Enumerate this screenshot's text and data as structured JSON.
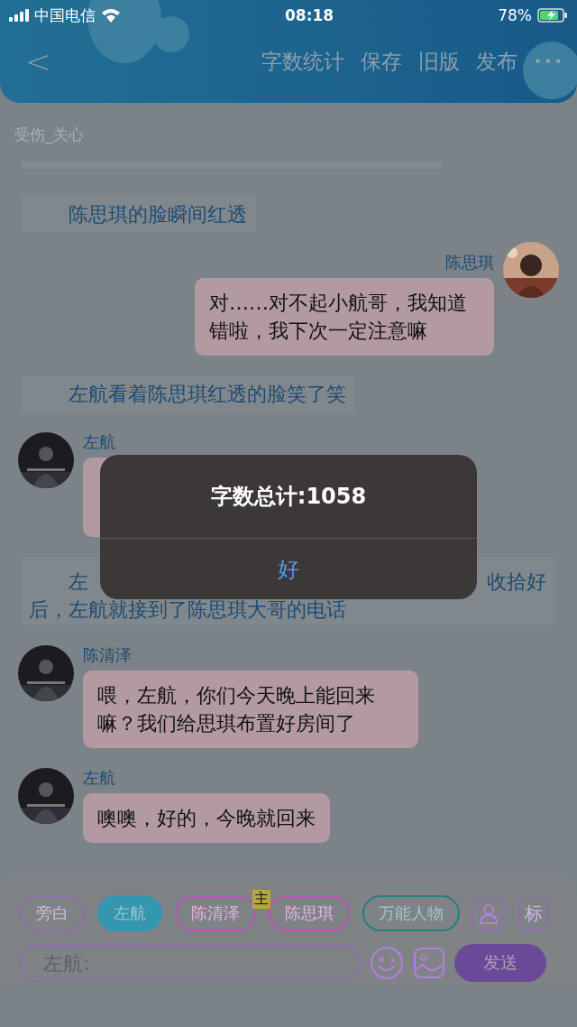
{
  "status_bar": {
    "carrier": "中国电信",
    "time": "08:18",
    "battery": "78%"
  },
  "header": {
    "back": "<",
    "actions": [
      "字数统计",
      "保存",
      "旧版",
      "发布"
    ],
    "more": "•••"
  },
  "scene_tag": "受伤_关心",
  "messages": [
    {
      "kind": "narration",
      "text": "陈思琪的脸瞬间红透"
    },
    {
      "kind": "right",
      "name": "陈思琪",
      "text": "对……对不起小航哥，我知道错啦，我下次一定注意嘛"
    },
    {
      "kind": "narration",
      "text": "左航看着陈思琪红透的脸笑了笑"
    },
    {
      "kind": "left",
      "name": "左航"
    },
    {
      "kind": "split_narration",
      "start": "左",
      "end": "收拾好",
      "text": "后，左航就接到了陈思琪大哥的电话"
    },
    {
      "kind": "left",
      "name": "陈清泽",
      "text": "喂，左航，你们今天晚上能回来嘛？我们给思琪布置好房间了"
    },
    {
      "kind": "left",
      "name": "左航",
      "text": "噢噢，好的，今晚就回来"
    }
  ],
  "roles": [
    {
      "label": "旁白",
      "selected": false,
      "color": "#8f6fae"
    },
    {
      "label": "左航",
      "selected": true,
      "color": "#3496b0"
    },
    {
      "label": "陈清泽",
      "selected": false,
      "color": "#b855b4"
    },
    {
      "label": "陈思琪",
      "selected": false,
      "color": "#b855b4",
      "badge": "主"
    },
    {
      "label": "万能人物",
      "selected": false,
      "color": "#2a7d80"
    }
  ],
  "tag_button": "标",
  "input": {
    "placeholder": "左航:"
  },
  "send_button": "发送",
  "alert": {
    "title": "字数总计:1058",
    "button": "好"
  }
}
